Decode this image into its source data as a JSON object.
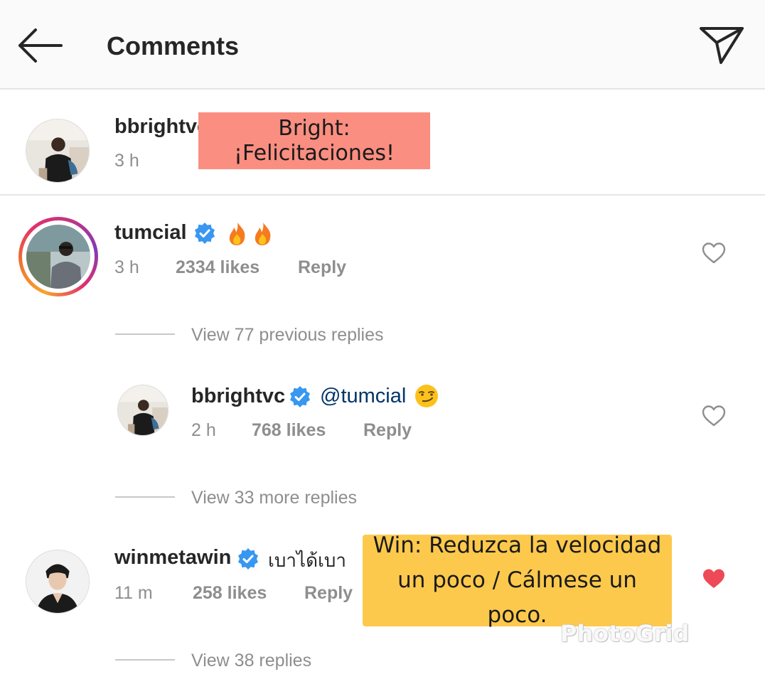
{
  "header": {
    "title": "Comments",
    "back_icon": "arrow-left-icon",
    "send_icon": "paper-plane-icon"
  },
  "caption_comment": {
    "username": "bbrightvc",
    "time": "3 h",
    "overlay_text": "Bright: ¡Felicitaciones!"
  },
  "comments": [
    {
      "username": "tumcial",
      "verified": true,
      "text": "🔥🔥",
      "time": "3 h",
      "likes": "2334 likes",
      "reply_label": "Reply",
      "liked": false,
      "view_replies": "View 77 previous replies"
    },
    {
      "username": "bbrightvc",
      "verified": true,
      "mention": "@tumcial",
      "text": "😏",
      "time": "2 h",
      "likes": "768 likes",
      "reply_label": "Reply",
      "liked": false,
      "view_replies": "View 33 more replies"
    },
    {
      "username": "winmetawin",
      "verified": true,
      "text": "เบาได้เบา",
      "time": "11 m",
      "likes": "258 likes",
      "reply_label": "Reply",
      "liked": true,
      "view_replies": "View 38 replies",
      "overlay_text": "Win: Reduzca la velocidad un poco / Cálmese un poco."
    }
  ],
  "watermark": "PhotoGrid",
  "colors": {
    "verified_blue": "#3897f0",
    "liked_red": "#ed4956",
    "overlay_red": "#fa8e80",
    "overlay_yellow": "#fdc94c"
  }
}
